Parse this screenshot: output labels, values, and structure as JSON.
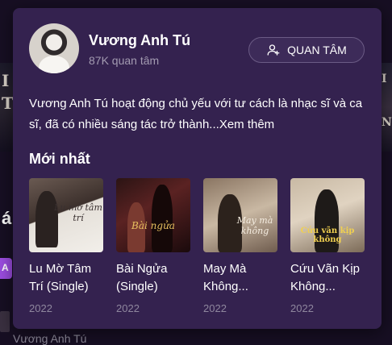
{
  "card": {
    "artist_name": "Vương Anh Tú",
    "followers": "87K quan tâm",
    "follow_label": "QUAN TÂM",
    "bio": "Vương Anh Tú hoạt động chủ yếu với tư cách là nhạc sĩ và ca sĩ, đã có nhiều sáng tác trở thành...",
    "bio_more": "Xem thêm",
    "section_title": "Mới nhất",
    "albums": [
      {
        "title": "Lu Mờ Tâm Trí (Single)",
        "year": "2022",
        "cover_text": "Lu mờ tâm trí"
      },
      {
        "title": "Bài Ngửa (Single)",
        "year": "2022",
        "cover_text": "Bài ngửa"
      },
      {
        "title": "May Mà Không...",
        "year": "2022",
        "cover_text": "May mà không"
      },
      {
        "title": "Cứu Vãn Kịp Không...",
        "year": "2022",
        "cover_text": "Cứu vãn kịp không"
      }
    ]
  },
  "background": {
    "left_letters": [
      "I",
      "T"
    ],
    "right_letters": [
      "I",
      "N"
    ],
    "left_fragment": "á",
    "chip_letter": "A",
    "bottom_name": "Vương Anh Tú"
  },
  "colors": {
    "page_bg": "#170f23",
    "card_bg": "#34224f",
    "muted_text": "#a39bb1",
    "accent_chip": "#9b4de0"
  }
}
